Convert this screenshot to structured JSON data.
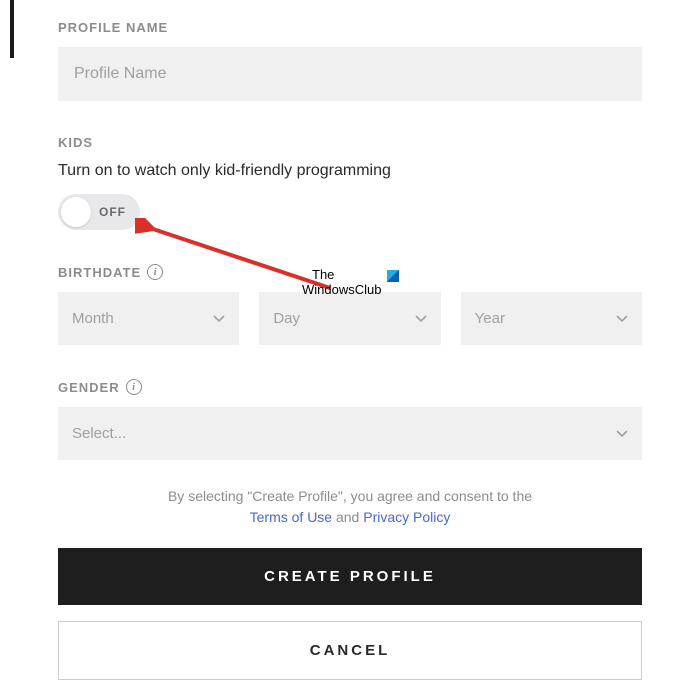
{
  "profile": {
    "label": "PROFILE NAME",
    "placeholder": "Profile Name"
  },
  "kids": {
    "label": "KIDS",
    "description": "Turn on to watch only kid-friendly programming",
    "toggle_state": "OFF"
  },
  "birthdate": {
    "label": "BIRTHDATE",
    "month": "Month",
    "day": "Day",
    "year": "Year"
  },
  "gender": {
    "label": "GENDER",
    "selected": "Select..."
  },
  "consent": {
    "prefix": "By selecting \"Create Profile\", you agree and consent to the",
    "terms": "Terms of Use",
    "and": "and",
    "privacy": "Privacy Policy"
  },
  "buttons": {
    "primary": "CREATE PROFILE",
    "secondary": "CANCEL"
  },
  "watermark": {
    "line1": "The",
    "line2": "WindowsClub"
  }
}
